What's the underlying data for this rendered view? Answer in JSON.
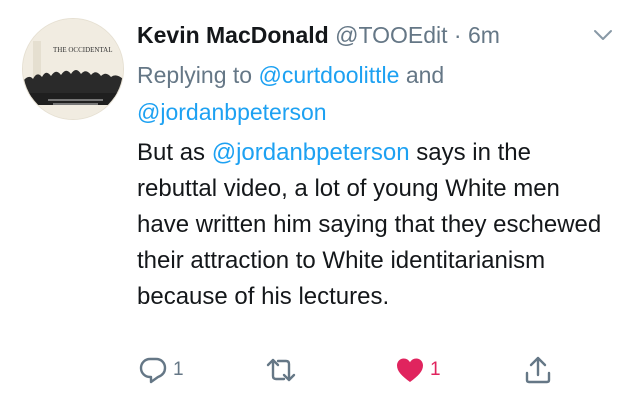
{
  "tweet": {
    "author_name": "Kevin MacDonald",
    "handle": "@TOOEdit",
    "separator": "·",
    "time": "6m",
    "replying_prefix": "Replying to",
    "reply_mention_1": "@curtdoolittle",
    "reply_conjunction": "and",
    "reply_mention_2": "@jordanbpeterson",
    "body_before_mention": "But as",
    "body_mention": "@jordanbpeterson",
    "body_after_mention": "says in the rebuttal video, a lot of young White men have written him saying that they eschewed their attraction to White identitarianism because of his lectures.",
    "avatar_logo_text": "THE OCCIDENTAL OBSERVER"
  },
  "actions": {
    "reply_icon": "reply-icon",
    "reply_count": "1",
    "retweet_icon": "retweet-icon",
    "retweet_count": "",
    "like_icon": "heart-icon",
    "like_count": "1",
    "like_color": "#e0245e",
    "share_icon": "share-icon"
  },
  "colors": {
    "mention": "#1da1f2",
    "secondary_text": "#657786",
    "primary_text": "#14171a"
  }
}
